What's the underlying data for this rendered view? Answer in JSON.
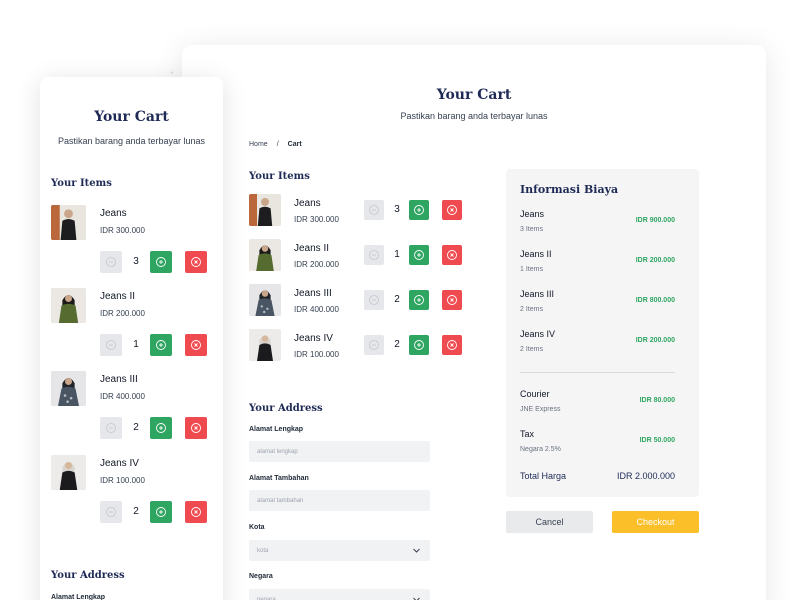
{
  "header": {
    "title": "Your Cart",
    "subtitle": "Pastikan barang anda terbayar lunas"
  },
  "breadcrumb": {
    "home": "Home",
    "separator": "/",
    "current": "Cart"
  },
  "items_heading": "Your Items",
  "items": [
    {
      "name": "Jeans",
      "price": "IDR 300.000",
      "qty": "3"
    },
    {
      "name": "Jeans II",
      "price": "IDR 200.000",
      "qty": "1"
    },
    {
      "name": "Jeans III",
      "price": "IDR 400.000",
      "qty": "2"
    },
    {
      "name": "Jeans IV",
      "price": "IDR 100.000",
      "qty": "2"
    }
  ],
  "address": {
    "heading": "Your Address",
    "fields": [
      {
        "label": "Alamat Lengkap",
        "placeholder": "alamat lengkap"
      },
      {
        "label": "Alamat Tambahan",
        "placeholder": "alamat tambahan"
      },
      {
        "label": "Kota",
        "value": "kota"
      },
      {
        "label": "Negara",
        "value": "negara"
      }
    ]
  },
  "summary": {
    "heading": "Informasi Biaya",
    "rows": [
      {
        "name": "Jeans",
        "count": "3 Items",
        "value": "IDR 900.000"
      },
      {
        "name": "Jeans II",
        "count": "1 Items",
        "value": "IDR 200.000"
      },
      {
        "name": "Jeans III",
        "count": "2 Items",
        "value": "IDR 800.000"
      },
      {
        "name": "Jeans IV",
        "count": "2 Items",
        "value": "IDR 200.000"
      }
    ],
    "courier": {
      "name": "Courier",
      "detail": "JNE Express",
      "value": "IDR 80.000"
    },
    "tax": {
      "name": "Tax",
      "detail": "Negara 2.5%",
      "value": "IDR 50.000"
    },
    "total": {
      "label": "Total Harga",
      "value": "IDR 2.000.000"
    }
  },
  "actions": {
    "cancel": "Cancel",
    "checkout": "Checkout"
  },
  "colors": {
    "navy": "#1e2a55",
    "green": "#2fa562",
    "red": "#ef4a4f",
    "yellow": "#fbbf2a",
    "gray_button": "#e5e7eb"
  },
  "icons": {
    "minus": "minus-circle-icon",
    "plus": "plus-circle-icon",
    "delete": "x-circle-icon",
    "dropdown": "chevron-down-icon"
  }
}
